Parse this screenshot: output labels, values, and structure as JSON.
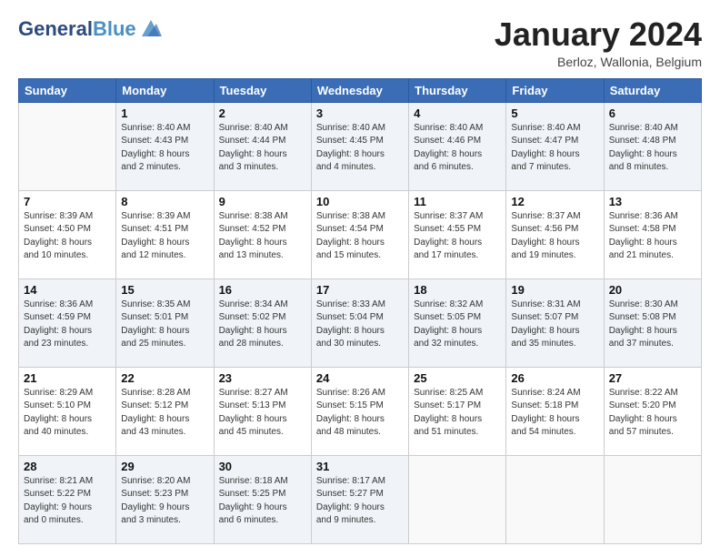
{
  "header": {
    "logo_general": "General",
    "logo_blue": "Blue",
    "month_title": "January 2024",
    "subtitle": "Berloz, Wallonia, Belgium"
  },
  "weekdays": [
    "Sunday",
    "Monday",
    "Tuesday",
    "Wednesday",
    "Thursday",
    "Friday",
    "Saturday"
  ],
  "weeks": [
    [
      {
        "day": "",
        "info": ""
      },
      {
        "day": "1",
        "info": "Sunrise: 8:40 AM\nSunset: 4:43 PM\nDaylight: 8 hours\nand 2 minutes."
      },
      {
        "day": "2",
        "info": "Sunrise: 8:40 AM\nSunset: 4:44 PM\nDaylight: 8 hours\nand 3 minutes."
      },
      {
        "day": "3",
        "info": "Sunrise: 8:40 AM\nSunset: 4:45 PM\nDaylight: 8 hours\nand 4 minutes."
      },
      {
        "day": "4",
        "info": "Sunrise: 8:40 AM\nSunset: 4:46 PM\nDaylight: 8 hours\nand 6 minutes."
      },
      {
        "day": "5",
        "info": "Sunrise: 8:40 AM\nSunset: 4:47 PM\nDaylight: 8 hours\nand 7 minutes."
      },
      {
        "day": "6",
        "info": "Sunrise: 8:40 AM\nSunset: 4:48 PM\nDaylight: 8 hours\nand 8 minutes."
      }
    ],
    [
      {
        "day": "7",
        "info": "Sunrise: 8:39 AM\nSunset: 4:50 PM\nDaylight: 8 hours\nand 10 minutes."
      },
      {
        "day": "8",
        "info": "Sunrise: 8:39 AM\nSunset: 4:51 PM\nDaylight: 8 hours\nand 12 minutes."
      },
      {
        "day": "9",
        "info": "Sunrise: 8:38 AM\nSunset: 4:52 PM\nDaylight: 8 hours\nand 13 minutes."
      },
      {
        "day": "10",
        "info": "Sunrise: 8:38 AM\nSunset: 4:54 PM\nDaylight: 8 hours\nand 15 minutes."
      },
      {
        "day": "11",
        "info": "Sunrise: 8:37 AM\nSunset: 4:55 PM\nDaylight: 8 hours\nand 17 minutes."
      },
      {
        "day": "12",
        "info": "Sunrise: 8:37 AM\nSunset: 4:56 PM\nDaylight: 8 hours\nand 19 minutes."
      },
      {
        "day": "13",
        "info": "Sunrise: 8:36 AM\nSunset: 4:58 PM\nDaylight: 8 hours\nand 21 minutes."
      }
    ],
    [
      {
        "day": "14",
        "info": "Sunrise: 8:36 AM\nSunset: 4:59 PM\nDaylight: 8 hours\nand 23 minutes."
      },
      {
        "day": "15",
        "info": "Sunrise: 8:35 AM\nSunset: 5:01 PM\nDaylight: 8 hours\nand 25 minutes."
      },
      {
        "day": "16",
        "info": "Sunrise: 8:34 AM\nSunset: 5:02 PM\nDaylight: 8 hours\nand 28 minutes."
      },
      {
        "day": "17",
        "info": "Sunrise: 8:33 AM\nSunset: 5:04 PM\nDaylight: 8 hours\nand 30 minutes."
      },
      {
        "day": "18",
        "info": "Sunrise: 8:32 AM\nSunset: 5:05 PM\nDaylight: 8 hours\nand 32 minutes."
      },
      {
        "day": "19",
        "info": "Sunrise: 8:31 AM\nSunset: 5:07 PM\nDaylight: 8 hours\nand 35 minutes."
      },
      {
        "day": "20",
        "info": "Sunrise: 8:30 AM\nSunset: 5:08 PM\nDaylight: 8 hours\nand 37 minutes."
      }
    ],
    [
      {
        "day": "21",
        "info": "Sunrise: 8:29 AM\nSunset: 5:10 PM\nDaylight: 8 hours\nand 40 minutes."
      },
      {
        "day": "22",
        "info": "Sunrise: 8:28 AM\nSunset: 5:12 PM\nDaylight: 8 hours\nand 43 minutes."
      },
      {
        "day": "23",
        "info": "Sunrise: 8:27 AM\nSunset: 5:13 PM\nDaylight: 8 hours\nand 45 minutes."
      },
      {
        "day": "24",
        "info": "Sunrise: 8:26 AM\nSunset: 5:15 PM\nDaylight: 8 hours\nand 48 minutes."
      },
      {
        "day": "25",
        "info": "Sunrise: 8:25 AM\nSunset: 5:17 PM\nDaylight: 8 hours\nand 51 minutes."
      },
      {
        "day": "26",
        "info": "Sunrise: 8:24 AM\nSunset: 5:18 PM\nDaylight: 8 hours\nand 54 minutes."
      },
      {
        "day": "27",
        "info": "Sunrise: 8:22 AM\nSunset: 5:20 PM\nDaylight: 8 hours\nand 57 minutes."
      }
    ],
    [
      {
        "day": "28",
        "info": "Sunrise: 8:21 AM\nSunset: 5:22 PM\nDaylight: 9 hours\nand 0 minutes."
      },
      {
        "day": "29",
        "info": "Sunrise: 8:20 AM\nSunset: 5:23 PM\nDaylight: 9 hours\nand 3 minutes."
      },
      {
        "day": "30",
        "info": "Sunrise: 8:18 AM\nSunset: 5:25 PM\nDaylight: 9 hours\nand 6 minutes."
      },
      {
        "day": "31",
        "info": "Sunrise: 8:17 AM\nSunset: 5:27 PM\nDaylight: 9 hours\nand 9 minutes."
      },
      {
        "day": "",
        "info": ""
      },
      {
        "day": "",
        "info": ""
      },
      {
        "day": "",
        "info": ""
      }
    ]
  ]
}
